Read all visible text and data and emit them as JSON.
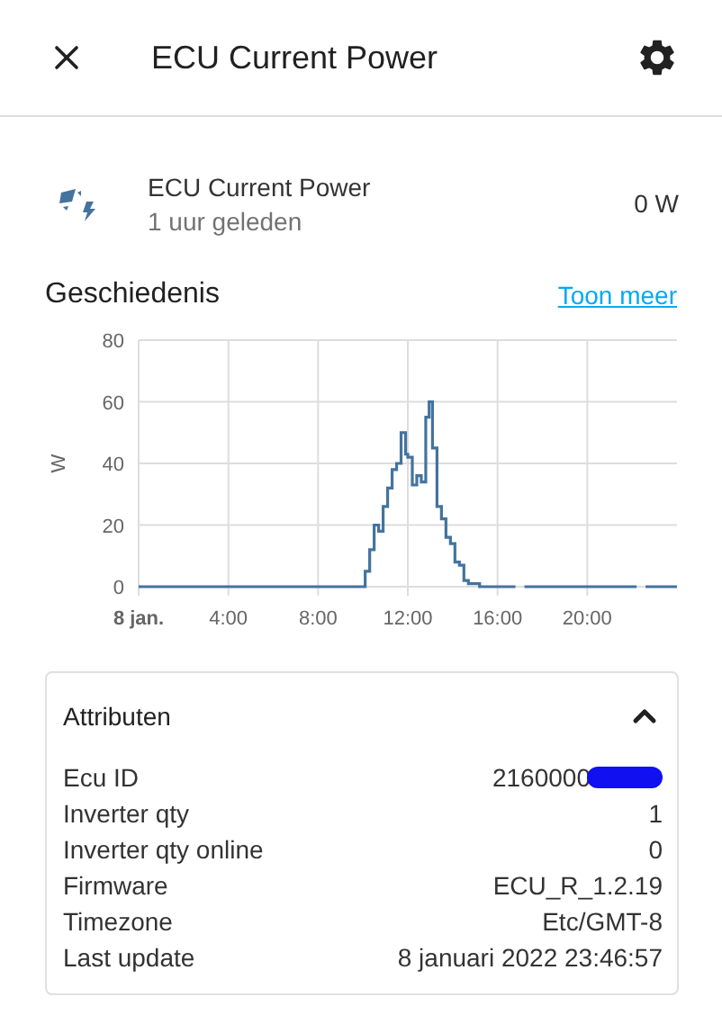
{
  "dialog": {
    "title": "ECU Current Power"
  },
  "entity": {
    "name": "ECU Current Power",
    "time": "1 uur geleden",
    "state": "0 W"
  },
  "history": {
    "title": "Geschiedenis",
    "link": "Toon meer",
    "chart_data": {
      "type": "line",
      "ylabel": "W",
      "xlim": [
        0,
        24
      ],
      "ylim": [
        0,
        80
      ],
      "xticks": [
        {
          "value": 0,
          "label": "8 jan."
        },
        {
          "value": 4,
          "label": "4:00"
        },
        {
          "value": 8,
          "label": "8:00"
        },
        {
          "value": 12,
          "label": "12:00"
        },
        {
          "value": 16,
          "label": "16:00"
        },
        {
          "value": 20,
          "label": "20:00"
        }
      ],
      "yticks": [
        0,
        20,
        40,
        60,
        80
      ],
      "grid": true,
      "x": [
        0,
        10,
        10.1,
        10.3,
        10.5,
        10.7,
        10.9,
        11.1,
        11.3,
        11.5,
        11.7,
        11.9,
        12,
        12.2,
        12.4,
        12.6,
        12.8,
        12.95,
        13.1,
        13.3,
        13.5,
        13.7,
        13.9,
        14.1,
        14.3,
        14.5,
        14.7,
        14.9,
        15.2,
        15.5,
        15.8,
        16.4,
        16.8,
        17.2,
        21.8,
        22.2,
        22.6,
        24
      ],
      "series": [
        {
          "color": "#44739e",
          "values": [
            0,
            0,
            5,
            12,
            20,
            18,
            26,
            32,
            38,
            40,
            50,
            43,
            42,
            33,
            36,
            34,
            55,
            60,
            45,
            26,
            22,
            16,
            14,
            8,
            7,
            2,
            1,
            1,
            0,
            0,
            0,
            0,
            null,
            0,
            0,
            null,
            0,
            0
          ]
        }
      ]
    }
  },
  "attributes": {
    "title": "Attributen",
    "expanded": true,
    "rows": [
      {
        "label": "Ecu ID",
        "value": "2160000",
        "redacted": true
      },
      {
        "label": "Inverter qty",
        "value": "1",
        "redacted": false
      },
      {
        "label": "Inverter qty online",
        "value": "0",
        "redacted": false
      },
      {
        "label": "Firmware",
        "value": "ECU_R_1.2.19",
        "redacted": false
      },
      {
        "label": "Timezone",
        "value": "Etc/GMT-8",
        "redacted": false
      },
      {
        "label": "Last update",
        "value": "8 januari 2022 23:46:57",
        "redacted": false
      }
    ]
  }
}
